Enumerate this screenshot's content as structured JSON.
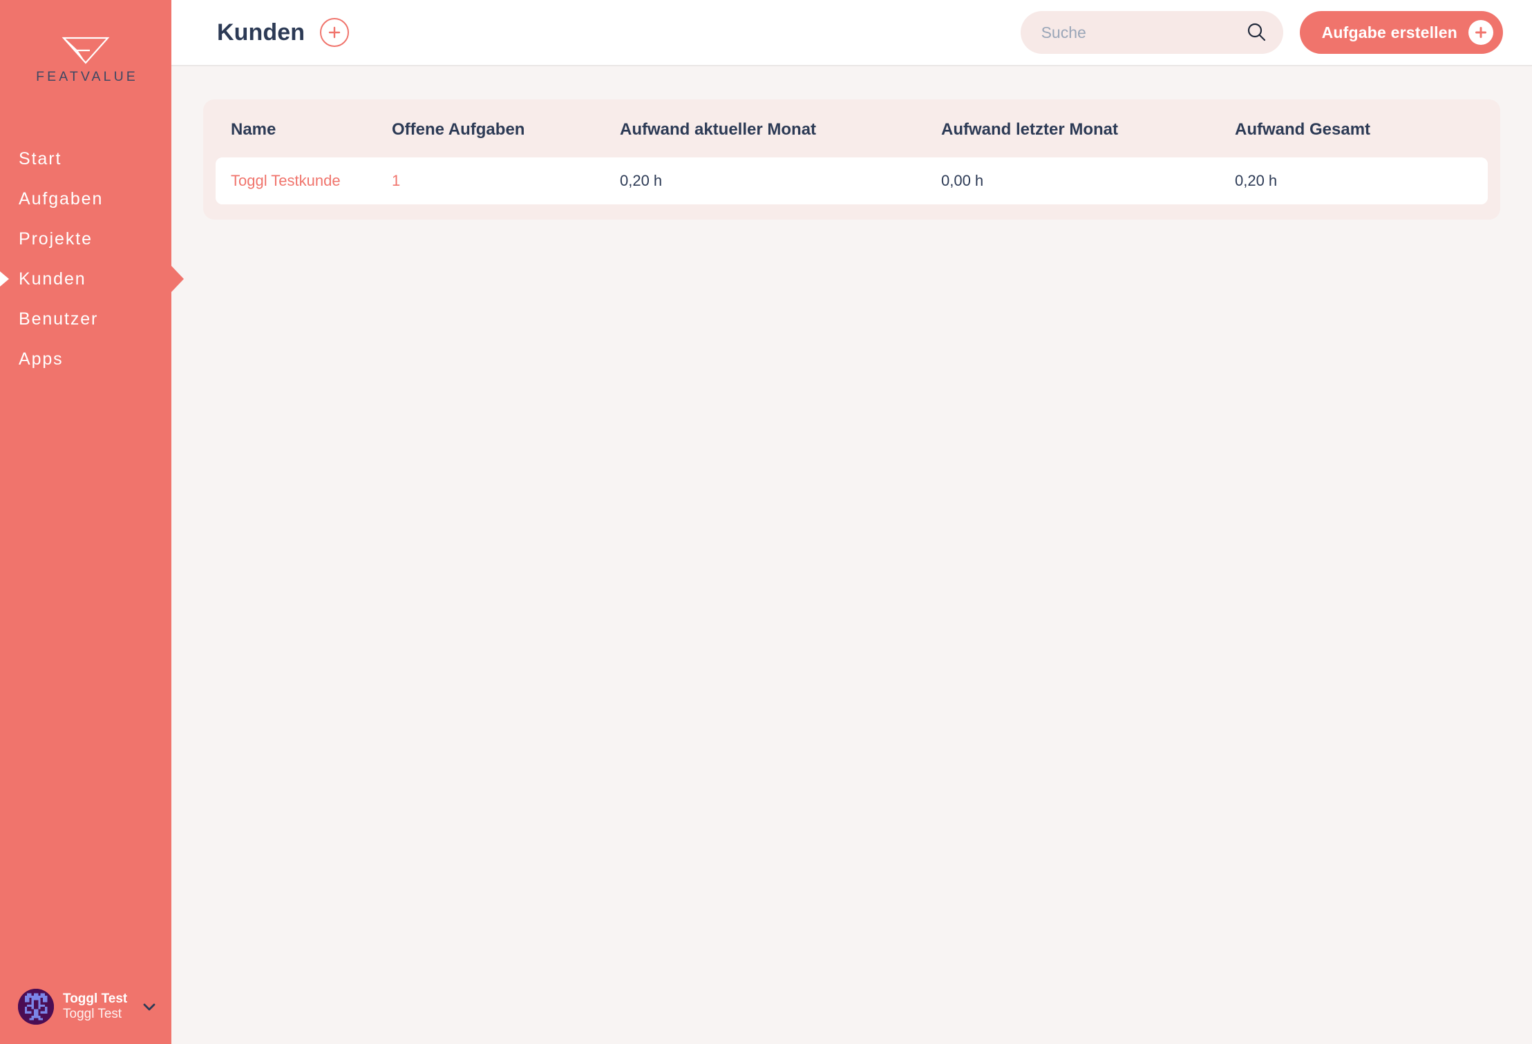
{
  "brand": {
    "logo_icon": "featvalue-triangle-logo",
    "wordmark": "FEATVALUE"
  },
  "colors": {
    "accent": "#f0746c",
    "text_dark": "#2c3a55",
    "page_bg": "#f8f4f3",
    "card_bg": "#f8ecea",
    "row_bg": "#ffffff",
    "search_bg": "#f7e9e7",
    "avatar_bg": "#4b0d54",
    "avatar_fg": "#7b86e8"
  },
  "sidebar": {
    "items": [
      {
        "label": "Start",
        "active": false
      },
      {
        "label": "Aufgaben",
        "active": false
      },
      {
        "label": "Projekte",
        "active": false
      },
      {
        "label": "Kunden",
        "active": true
      },
      {
        "label": "Benutzer",
        "active": false
      },
      {
        "label": "Apps",
        "active": false
      }
    ],
    "user": {
      "name": "Toggl Test",
      "workspace": "Toggl Test",
      "chevron_icon": "chevron-down-icon",
      "avatar_icon": "avatar-identicon"
    }
  },
  "topbar": {
    "title": "Kunden",
    "add_icon": "plus-icon",
    "search": {
      "placeholder": "Suche",
      "value": "",
      "icon": "search-icon"
    },
    "cta": {
      "label": "Aufgabe erstellen",
      "icon": "plus-icon"
    }
  },
  "table": {
    "columns": [
      "Name",
      "Offene Aufgaben",
      "Aufwand aktueller Monat",
      "Aufwand letzter Monat",
      "Aufwand Gesamt"
    ],
    "rows": [
      {
        "name": "Toggl Testkunde",
        "open_tasks": "1",
        "effort_current_month": "0,20 h",
        "effort_last_month": "0,00 h",
        "effort_total": "0,20 h"
      }
    ]
  }
}
